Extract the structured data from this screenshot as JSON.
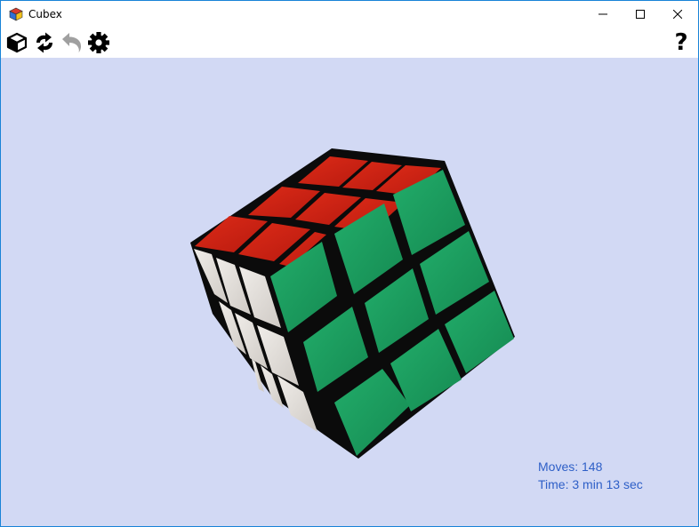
{
  "window": {
    "title": "Cubex",
    "icons": {
      "app": "cube-app-icon",
      "minimize": "minimize-icon",
      "maximize": "maximize-icon",
      "close": "close-icon"
    }
  },
  "toolbar": {
    "items": [
      {
        "name": "new-cube-button",
        "icon": "cube-icon",
        "enabled": true
      },
      {
        "name": "shuffle-button",
        "icon": "shuffle-arrows-icon",
        "enabled": true
      },
      {
        "name": "undo-button",
        "icon": "undo-arrow-icon",
        "enabled": false
      },
      {
        "name": "settings-button",
        "icon": "gear-icon",
        "enabled": true
      },
      {
        "name": "help-button",
        "icon": "question-mark-icon",
        "enabled": true
      }
    ],
    "help_glyph": "?"
  },
  "status": {
    "moves_label": "Moves:",
    "moves_value": "148",
    "time_label": "Time:",
    "time_value": "3 min 13 sec"
  },
  "cube": {
    "colors": {
      "top": "#cc2014",
      "front": "#1aa060",
      "left": "#e4e0dc",
      "body": "#0a0a0a"
    }
  },
  "colors": {
    "viewport_bg": "#d2d9f4",
    "stats_text": "#2e5fc7",
    "window_border": "#1883d7",
    "disabled_icon": "#a0a0a0"
  }
}
